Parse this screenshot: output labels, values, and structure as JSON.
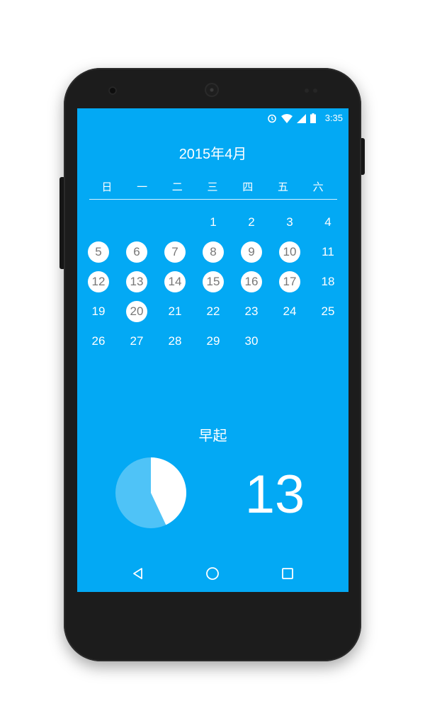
{
  "status_bar": {
    "time": "3:35",
    "icons": [
      "alarm-icon",
      "wifi-icon",
      "signal-icon",
      "battery-icon"
    ]
  },
  "calendar": {
    "title": "2015年4月",
    "weekdays": [
      "日",
      "一",
      "二",
      "三",
      "四",
      "五",
      "六"
    ],
    "first_weekday_index": 3,
    "days": [
      {
        "label": "1",
        "marked": false
      },
      {
        "label": "2",
        "marked": false
      },
      {
        "label": "3",
        "marked": false
      },
      {
        "label": "4",
        "marked": false
      },
      {
        "label": "5",
        "marked": true
      },
      {
        "label": "6",
        "marked": true
      },
      {
        "label": "7",
        "marked": true
      },
      {
        "label": "8",
        "marked": true
      },
      {
        "label": "9",
        "marked": true
      },
      {
        "label": "10",
        "marked": true
      },
      {
        "label": "11",
        "marked": false
      },
      {
        "label": "12",
        "marked": true
      },
      {
        "label": "13",
        "marked": true
      },
      {
        "label": "14",
        "marked": true
      },
      {
        "label": "15",
        "marked": true
      },
      {
        "label": "16",
        "marked": true
      },
      {
        "label": "17",
        "marked": true
      },
      {
        "label": "18",
        "marked": false
      },
      {
        "label": "19",
        "marked": false
      },
      {
        "label": "20",
        "marked": true
      },
      {
        "label": "21",
        "marked": false
      },
      {
        "label": "22",
        "marked": false
      },
      {
        "label": "23",
        "marked": false
      },
      {
        "label": "24",
        "marked": false
      },
      {
        "label": "25",
        "marked": false
      },
      {
        "label": "26",
        "marked": false
      },
      {
        "label": "27",
        "marked": false
      },
      {
        "label": "28",
        "marked": false
      },
      {
        "label": "29",
        "marked": false
      },
      {
        "label": "30",
        "marked": false
      }
    ]
  },
  "stats": {
    "title": "早起",
    "count": "13",
    "pie_fraction": 0.43
  },
  "nav_bar": {
    "icons": [
      "back-icon",
      "home-icon",
      "recents-icon"
    ]
  },
  "colors": {
    "screen_background": "#03a9f4",
    "pie_background": "#4fc3f7",
    "pie_fill": "#ffffff",
    "marked_text": "#777777"
  }
}
